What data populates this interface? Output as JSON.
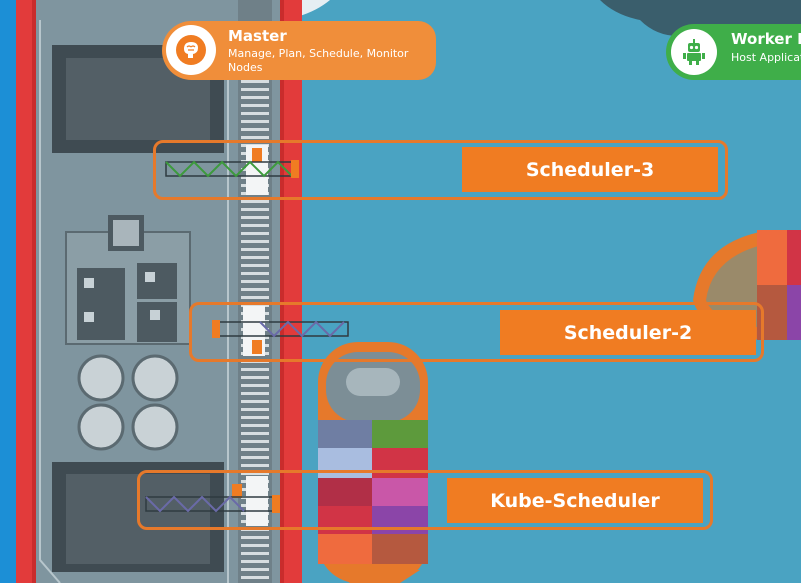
{
  "master": {
    "title": "Master",
    "subtitle": "Manage, Plan, Schedule, Monitor Nodes",
    "icon": "brain-icon",
    "color": "#f08e3a"
  },
  "worker": {
    "title": "Worker N",
    "subtitle": "Host Applicat",
    "icon": "robot-icon",
    "color": "#3fae49"
  },
  "schedulers": [
    {
      "label": "Scheduler-3"
    },
    {
      "label": "Scheduler-2"
    },
    {
      "label": "Kube-Scheduler"
    }
  ],
  "colors": {
    "sea": "#4aa3c2",
    "accent": "#f07c22",
    "frame": "#e6792b",
    "dock": "#7f959f"
  }
}
